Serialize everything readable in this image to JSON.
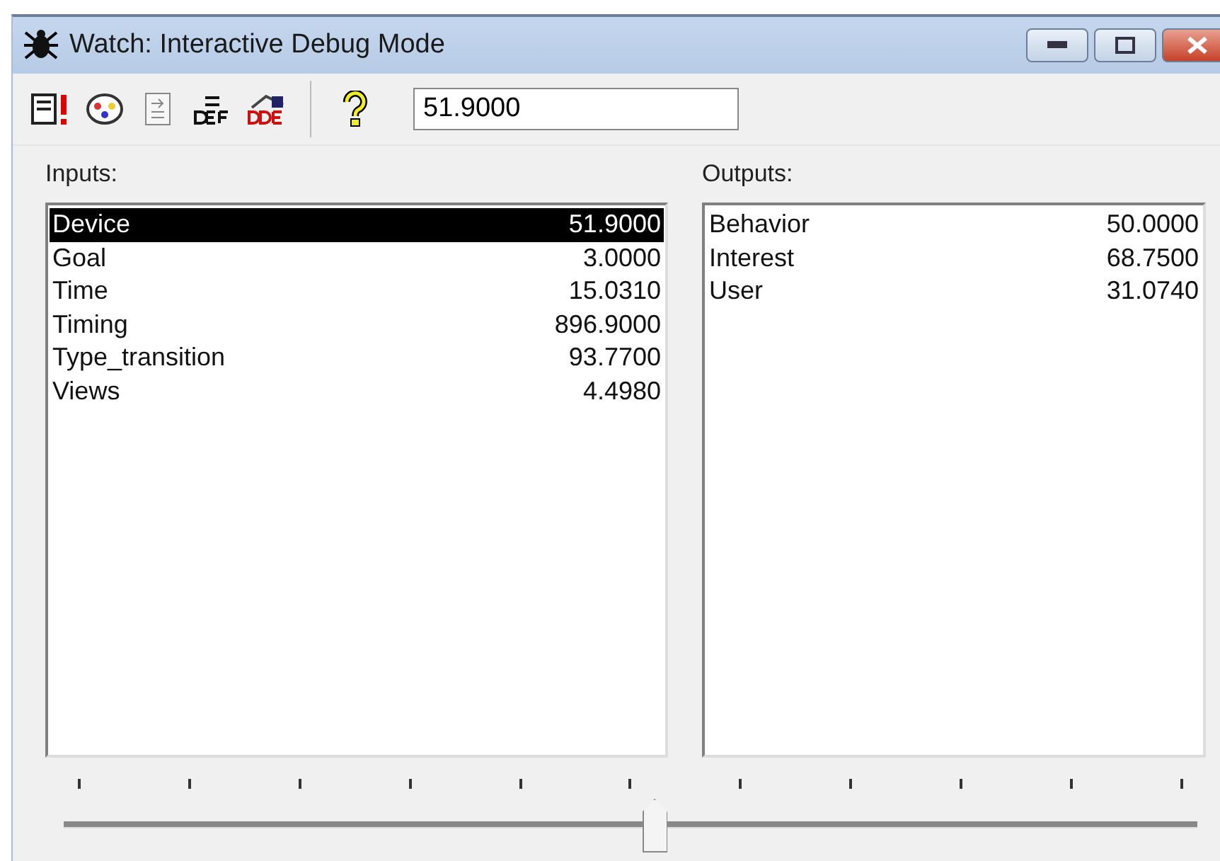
{
  "window": {
    "title": "Watch: Interactive Debug Mode"
  },
  "toolbar": {
    "value": "51.9000"
  },
  "inputs": {
    "label": "Inputs:",
    "rows": [
      {
        "name": "Device",
        "value": "51.9000",
        "selected": true
      },
      {
        "name": "Goal",
        "value": "3.0000",
        "selected": false
      },
      {
        "name": "Time",
        "value": "15.0310",
        "selected": false
      },
      {
        "name": "Timing",
        "value": "896.9000",
        "selected": false
      },
      {
        "name": "Type_transition",
        "value": "93.7700",
        "selected": false
      },
      {
        "name": "Views",
        "value": "4.4980",
        "selected": false
      }
    ]
  },
  "outputs": {
    "label": "Outputs:",
    "rows": [
      {
        "name": "Behavior",
        "value": "50.0000",
        "selected": false
      },
      {
        "name": "Interest",
        "value": "68.7500",
        "selected": false
      },
      {
        "name": "User",
        "value": "31.0740",
        "selected": false
      }
    ]
  },
  "slider": {
    "level": 0.52
  }
}
